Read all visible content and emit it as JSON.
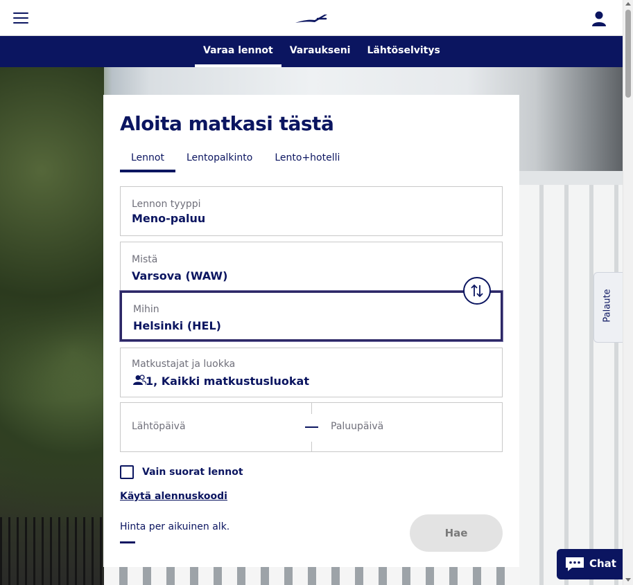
{
  "header": {
    "menu_icon": "hamburger-menu-icon",
    "logo_icon": "finnair-logo-icon",
    "user_icon": "user-icon"
  },
  "nav": {
    "tabs": [
      {
        "label": "Varaa lennot",
        "active": true
      },
      {
        "label": "Varaukseni",
        "active": false
      },
      {
        "label": "Lähtöselvitys",
        "active": false
      }
    ]
  },
  "booking": {
    "title": "Aloita matkasi tästä",
    "tabs": [
      {
        "label": "Lennot",
        "active": true
      },
      {
        "label": "Lentopalkinto",
        "active": false
      },
      {
        "label": "Lento+hotelli",
        "active": false
      }
    ],
    "trip_type": {
      "label": "Lennon tyyppi",
      "value": "Meno-paluu"
    },
    "from": {
      "label": "Mistä",
      "value": "Varsova (WAW)"
    },
    "to": {
      "label": "Mihin",
      "value": "Helsinki (HEL)"
    },
    "swap_icon": "swap-arrows-icon",
    "passengers": {
      "label": "Matkustajat ja luokka",
      "value": "1, Kaikki matkustusluokat",
      "icon": "passengers-icon"
    },
    "departure": {
      "placeholder": "Lähtöpäivä"
    },
    "return": {
      "placeholder": "Paluupäivä"
    },
    "direct_only": {
      "label": "Vain suorat lennot",
      "checked": false
    },
    "promo_link": "Käytä alennuskoodi",
    "price_label": "Hinta per aikuinen alk.",
    "search_button": "Hae"
  },
  "feedback_label": "Palaute",
  "chat": {
    "label": "Chat",
    "icon": "chat-bubble-icon"
  },
  "colors": {
    "brand": "#0b1560",
    "focus": "#2c2766",
    "disabled": "#e3e3e3"
  }
}
